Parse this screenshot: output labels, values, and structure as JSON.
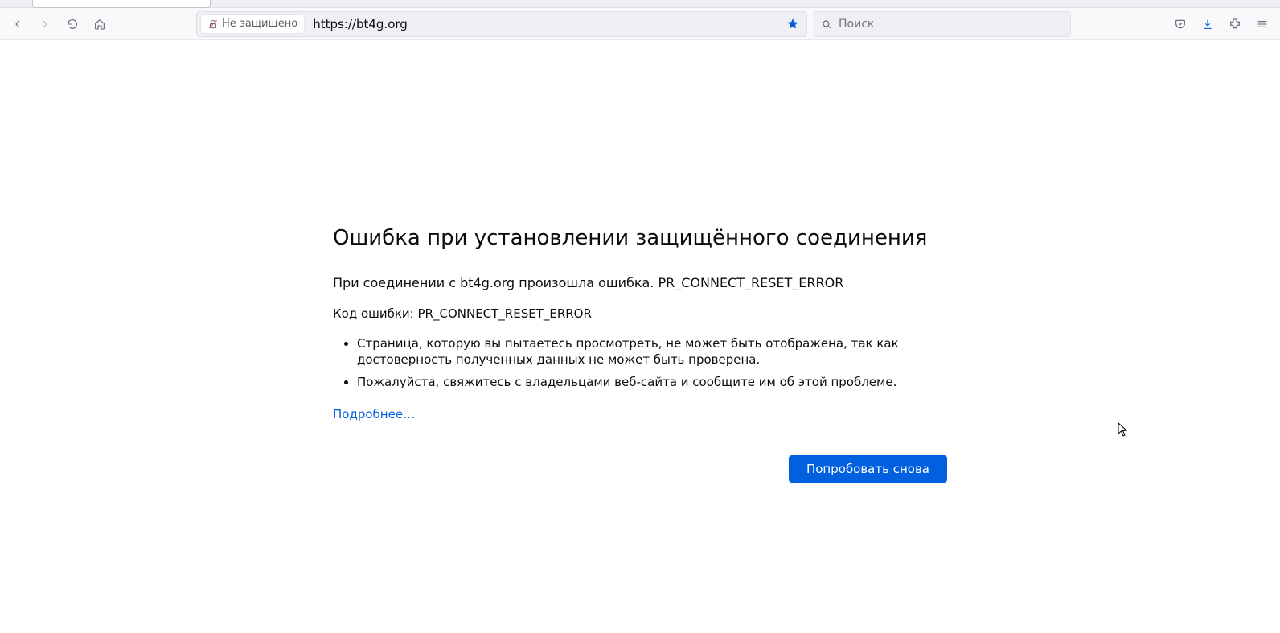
{
  "toolbar": {
    "url_security_label": "Не защищено",
    "url_value": "https://bt4g.org",
    "search_placeholder": "Поиск"
  },
  "error": {
    "title": "Ошибка при установлении защищённого соединения",
    "subtitle": "При соединении с bt4g.org произошла ошибка. PR_CONNECT_RESET_ERROR",
    "code_line": "Код ошибки: PR_CONNECT_RESET_ERROR",
    "bullets": [
      "Страница, которую вы пытаетесь просмотреть, не может быть отображена, так как достоверность полученных данных не может быть проверена.",
      "Пожалуйста, свяжитесь с владельцами веб-сайта и сообщите им об этой проблеме."
    ],
    "more_link": "Подробнее…",
    "retry_button": "Попробовать снова"
  }
}
